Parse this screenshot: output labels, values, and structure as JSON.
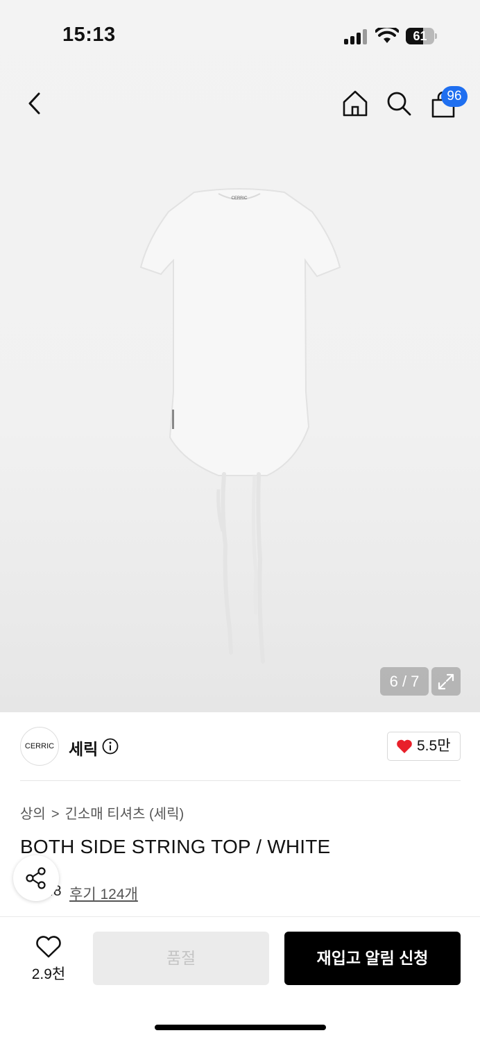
{
  "status": {
    "time": "15:13",
    "battery_level": "61",
    "battery_fraction": 0.61
  },
  "nav": {
    "back_icon": "chevron-left-icon",
    "home_icon": "home-icon",
    "search_icon": "search-icon",
    "cart_icon": "shopping-bag-icon",
    "cart_count": "96",
    "badge_color": "#1f6ff0"
  },
  "gallery": {
    "current": 6,
    "total": 7,
    "counter_text": "6 / 7",
    "product_label": "CERRIC",
    "expand_icon": "expand-icon"
  },
  "brand": {
    "logo_text": "CERRIC",
    "name": "세릭",
    "info_icon": "info-icon",
    "like_icon": "heart-icon",
    "like_count": "5.5만",
    "heart_color": "#e8202a"
  },
  "product": {
    "breadcrumb": [
      "상의",
      "긴소매 티셔츠 (세릭)"
    ],
    "breadcrumb_separator": ">",
    "title": "BOTH SIDE STRING TOP / WHITE",
    "rating": "4.8",
    "rating_visible": ".8",
    "reviews": "후기 124개"
  },
  "share": {
    "icon": "share-icon"
  },
  "bottom": {
    "wish_icon": "heart-outline-icon",
    "wish_count": "2.9천",
    "soldout_label": "품절",
    "restock_label": "재입고 알림 신청"
  }
}
